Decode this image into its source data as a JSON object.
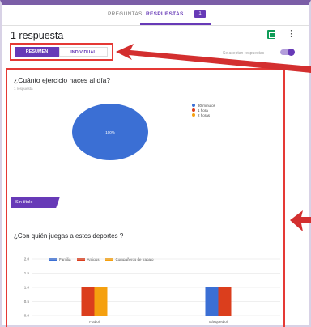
{
  "tabs": {
    "preguntas": "PREGUNTAS",
    "respuestas": "RESPUESTAS",
    "respuestas_count": "1"
  },
  "header": {
    "title": "1 respuesta",
    "accepting_label": "Se aceptan respuestas"
  },
  "view_toggle": {
    "resumen": "RESUMEN",
    "individual": "INDIVIDUAL"
  },
  "colors": {
    "accent": "#673ab7",
    "highlight_red": "#e53935",
    "blue": "#3b6fd4",
    "red": "#db3e1d",
    "orange": "#f5a00f"
  },
  "question1": {
    "title": "¿Cuánto ejercicio haces al día?",
    "count": "1 respuesta"
  },
  "section_label": "Sin título",
  "question2": {
    "title": "¿Con quién juegas a estos deportes ?"
  },
  "chart_data": [
    {
      "type": "pie",
      "labels": [
        "30 minutos",
        "1 hora",
        "2 horas"
      ],
      "values": [
        100,
        0,
        0
      ],
      "colors": [
        "#3b6fd4",
        "#db3e1d",
        "#f5a00f"
      ],
      "data_labels": [
        "100%"
      ],
      "legend": "right"
    },
    {
      "type": "bar",
      "categories": [
        "Futbol",
        "Básquetbol"
      ],
      "series": [
        {
          "name": "Familia",
          "values": [
            0,
            1
          ],
          "color": "#3b6fd4"
        },
        {
          "name": "Amigos",
          "values": [
            1,
            1
          ],
          "color": "#db3e1d"
        },
        {
          "name": "Compañeros de trabajo",
          "values": [
            1,
            0
          ],
          "color": "#f5a00f"
        }
      ],
      "ylim": [
        0,
        2
      ],
      "yticks": [
        "0.0",
        "0.5",
        "1.0",
        "1.5",
        "2.0"
      ],
      "grid": true,
      "legend": "top"
    }
  ]
}
